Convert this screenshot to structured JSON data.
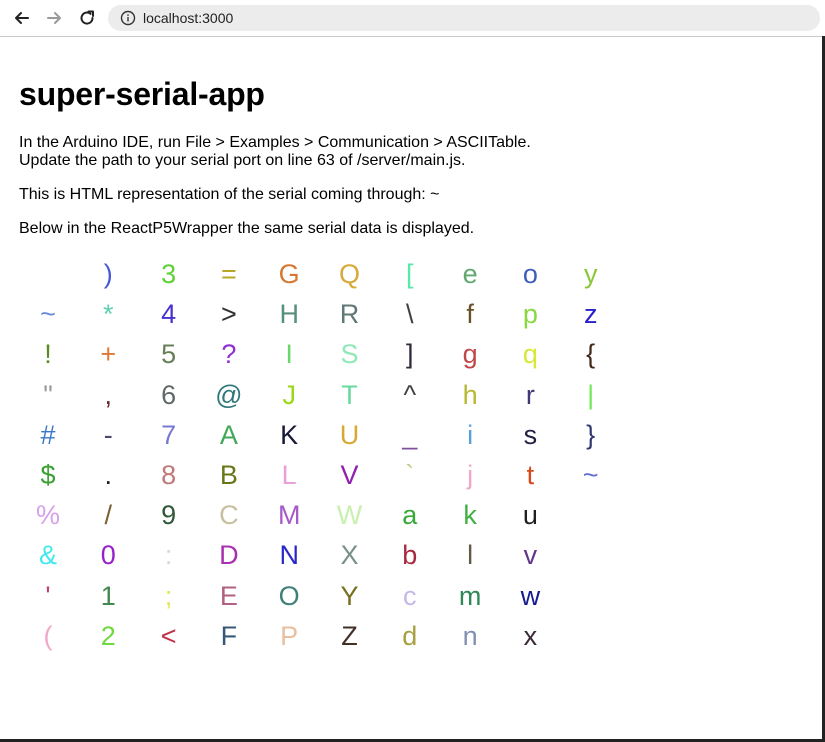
{
  "browser": {
    "url": "localhost:3000"
  },
  "page": {
    "title": "super-serial-app",
    "line1": "In the Arduino IDE, run File > Examples > Communication > ASCIITable.",
    "line2": "Update the path to your serial port on line 63 of /server/main.js.",
    "line3": "This is HTML representation of the serial coming through: ~",
    "line4": "Below in the ReactP5Wrapper the same serial data is displayed."
  },
  "serial_grid": {
    "rows_per_column": 10,
    "columns": [
      [
        {
          "c": " ",
          "color": "#000000"
        },
        {
          "c": "~",
          "color": "#6a8ad8"
        },
        {
          "c": "!",
          "color": "#5a8a20"
        },
        {
          "c": "\"",
          "color": "#9a9a9a"
        },
        {
          "c": "#",
          "color": "#3a78c8"
        },
        {
          "c": "$",
          "color": "#3aa030"
        },
        {
          "c": "%",
          "color": "#d8a0e8"
        },
        {
          "c": "&",
          "color": "#40e8f0"
        },
        {
          "c": "'",
          "color": "#c84060"
        },
        {
          "c": "(",
          "color": "#f0a8c8"
        }
      ],
      [
        {
          "c": ")",
          "color": "#4858d8"
        },
        {
          "c": "*",
          "color": "#60d0b0"
        },
        {
          "c": "+",
          "color": "#e07838"
        },
        {
          "c": ",",
          "color": "#682828"
        },
        {
          "c": "-",
          "color": "#484868"
        },
        {
          "c": ".",
          "color": "#202020"
        },
        {
          "c": "/",
          "color": "#786030"
        },
        {
          "c": "0",
          "color": "#9820c8"
        },
        {
          "c": "1",
          "color": "#408850"
        },
        {
          "c": "2",
          "color": "#70d840"
        }
      ],
      [
        {
          "c": "3",
          "color": "#60d038"
        },
        {
          "c": "4",
          "color": "#4830d0"
        },
        {
          "c": "5",
          "color": "#688058"
        },
        {
          "c": "6",
          "color": "#606868"
        },
        {
          "c": "7",
          "color": "#7878d0"
        },
        {
          "c": "8",
          "color": "#c07878"
        },
        {
          "c": "9",
          "color": "#305838"
        },
        {
          "c": ":",
          "color": "#d8d8d8"
        },
        {
          "c": ";",
          "color": "#e0e850"
        },
        {
          "c": "<",
          "color": "#c03048"
        }
      ],
      [
        {
          "c": "=",
          "color": "#b8a828"
        },
        {
          "c": ">",
          "color": "#303030"
        },
        {
          "c": "?",
          "color": "#9030d0"
        },
        {
          "c": "@",
          "color": "#30787a"
        },
        {
          "c": "A",
          "color": "#40a858"
        },
        {
          "c": "B",
          "color": "#687818"
        },
        {
          "c": "C",
          "color": "#c8c0a0"
        },
        {
          "c": "D",
          "color": "#a830b0"
        },
        {
          "c": "E",
          "color": "#b06080"
        },
        {
          "c": "F",
          "color": "#385878"
        }
      ],
      [
        {
          "c": "G",
          "color": "#d87830"
        },
        {
          "c": "H",
          "color": "#589080"
        },
        {
          "c": "I",
          "color": "#68d868"
        },
        {
          "c": "J",
          "color": "#98d818"
        },
        {
          "c": "K",
          "color": "#181838"
        },
        {
          "c": "L",
          "color": "#e8a0d8"
        },
        {
          "c": "M",
          "color": "#a858c8"
        },
        {
          "c": "N",
          "color": "#2828c8"
        },
        {
          "c": "O",
          "color": "#408078"
        },
        {
          "c": "P",
          "color": "#e8c0a0"
        }
      ],
      [
        {
          "c": "Q",
          "color": "#d8a838"
        },
        {
          "c": "R",
          "color": "#607878"
        },
        {
          "c": "S",
          "color": "#90e8b8"
        },
        {
          "c": "T",
          "color": "#68d8a0"
        },
        {
          "c": "U",
          "color": "#d8a830"
        },
        {
          "c": "V",
          "color": "#9020b0"
        },
        {
          "c": "W",
          "color": "#c8f0b0"
        },
        {
          "c": "X",
          "color": "#7a9088"
        },
        {
          "c": "Y",
          "color": "#787020"
        },
        {
          "c": "Z",
          "color": "#403028"
        }
      ],
      [
        {
          "c": "[",
          "color": "#58e8a8"
        },
        {
          "c": "\\",
          "color": "#404040"
        },
        {
          "c": "]",
          "color": "#302838"
        },
        {
          "c": "^",
          "color": "#404040"
        },
        {
          "c": "_",
          "color": "#8050a0"
        },
        {
          "c": "`",
          "color": "#c8c888"
        },
        {
          "c": "a",
          "color": "#38a838"
        },
        {
          "c": "b",
          "color": "#a82840"
        },
        {
          "c": "c",
          "color": "#c8b8e8"
        },
        {
          "c": "d",
          "color": "#a8a040"
        }
      ],
      [
        {
          "c": "e",
          "color": "#60a870"
        },
        {
          "c": "f",
          "color": "#685028"
        },
        {
          "c": "g",
          "color": "#c04848"
        },
        {
          "c": "h",
          "color": "#b8b830"
        },
        {
          "c": "i",
          "color": "#58a0d8"
        },
        {
          "c": "j",
          "color": "#f0a8c8"
        },
        {
          "c": "k",
          "color": "#40b040"
        },
        {
          "c": "l",
          "color": "#605848"
        },
        {
          "c": "m",
          "color": "#308858"
        },
        {
          "c": "n",
          "color": "#8090b0"
        }
      ],
      [
        {
          "c": "o",
          "color": "#4060b8"
        },
        {
          "c": "p",
          "color": "#88d840"
        },
        {
          "c": "q",
          "color": "#d8e838"
        },
        {
          "c": "r",
          "color": "#403870"
        },
        {
          "c": "s",
          "color": "#202040"
        },
        {
          "c": "t",
          "color": "#d84818"
        },
        {
          "c": "u",
          "color": "#202020"
        },
        {
          "c": "v",
          "color": "#603888"
        },
        {
          "c": "w",
          "color": "#181890"
        },
        {
          "c": "x",
          "color": "#382838"
        }
      ],
      [
        {
          "c": "y",
          "color": "#88c838"
        },
        {
          "c": "z",
          "color": "#2820c8"
        },
        {
          "c": "{",
          "color": "#402818"
        },
        {
          "c": "|",
          "color": "#70e858"
        },
        {
          "c": "}",
          "color": "#303870"
        },
        {
          "c": "~",
          "color": "#6070d0"
        }
      ]
    ]
  }
}
